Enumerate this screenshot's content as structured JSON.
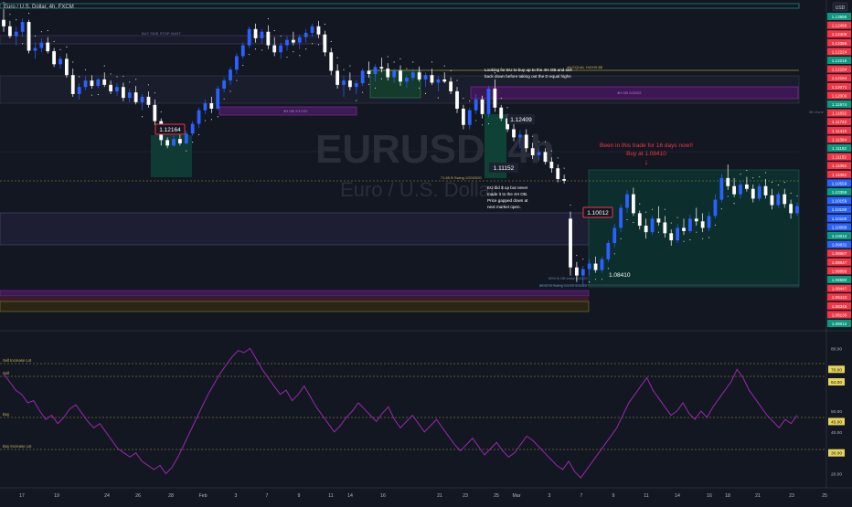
{
  "header": {
    "title": "Euro / U.S. Dollar, 4h, FXCM",
    "currency": "USD"
  },
  "watermark": {
    "symbol": "EURUSD, 4h",
    "name": "Euro / U.S. Dollar"
  },
  "colors": {
    "bg": "#131722",
    "up": "#2962ff",
    "down": "#ffffff",
    "price_label": "#f23645",
    "green_label": "#089981",
    "blue_label": "#2962ff",
    "rsi": "#9c27b0",
    "dots": "#ffffff",
    "zone_dark": "#1e2130",
    "teal_zone": "#0d3b35",
    "purple_zone": "#4a1d6b",
    "yellow_zone": "#3a3318"
  },
  "annotations": {
    "top_zone_label": "BUY SIDE STOP HUNT",
    "ob_label_1": "4H OB 2/17/22",
    "ob_label_2": "4H OB 2/22/22",
    "equal_highs": "4H EQUAL HIGHS $$",
    "looking_for": [
      "Looking for EU to buy up to the 4H OB and sell",
      "back down before taking out the D equal highs"
    ],
    "swing_label": "71.85 B Swing 1/20/2020",
    "eu_did": [
      "EU did $ up but never",
      "made it to the 4H OB.",
      "Price gapped down at",
      "next market open."
    ],
    "fib_label_1": "50% B OB ends 5/11/22",
    "fib_label_2": "88.62 B Swing 1/2/20 5/11/22",
    "been_in_trade": [
      "Been in this trade for 16 days now!!",
      "Buy at 1.08410"
    ],
    "arrow": "↓",
    "fifth_zone": "5th Zone"
  },
  "price_callouts": {
    "p1": "1.12164",
    "p2": "1.12409",
    "p3": "1.11152",
    "p4": "1.10012",
    "p5": "1.08410"
  },
  "price_axis": [
    "1.13555",
    "1.12468",
    "1.12409",
    "1.12356",
    "1.12224",
    "1.12216",
    "1.12164",
    "1.12154",
    "1.12071",
    "1.12006",
    "1.11974",
    "1.11832",
    "1.11722",
    "1.11410",
    "1.11364",
    "1.11152",
    "1.11152",
    "1.11062",
    "1.11062",
    "1.10559",
    "1.10359",
    "1.10159",
    "1.10190",
    "1.10100",
    "1.10089",
    "1.10012",
    "1.09831",
    "1.08987",
    "1.08947",
    "1.08890",
    "1.08580",
    "1.08447",
    "1.08410",
    "1.08346",
    "1.08130",
    "1.08012"
  ],
  "rsi_axis": [
    "80.00",
    "70.00",
    "64.00",
    "50.00",
    "45.00",
    "40.00",
    "30.00",
    "20.00"
  ],
  "rsi_levels": {
    "sell_increase": {
      "label": "Sell Increase Lot",
      "value": "70.00"
    },
    "sell": {
      "label": "Sell",
      "value": "64.00"
    },
    "buy": {
      "label": "Buy",
      "value": "45.00"
    },
    "buy_increase": {
      "label": "Buy Increase Lot",
      "value": "30.00"
    }
  },
  "time_axis": [
    "17",
    "19",
    "24",
    "26",
    "28",
    "Feb",
    "3",
    "7",
    "9",
    "11",
    "14",
    "16",
    "21",
    "23",
    "25",
    "Mar",
    "3",
    "7",
    "9",
    "11",
    "14",
    "16",
    "18",
    "21",
    "23",
    "25"
  ],
  "chart_data": {
    "type": "candlestick",
    "title": "Euro / U.S. Dollar, 4h, FXCM",
    "ylim": [
      1.0795,
      1.1365
    ],
    "rsi_ylim": [
      15,
      85
    ],
    "candles": [
      [
        1.1352,
        1.1372,
        1.133,
        1.134
      ],
      [
        1.134,
        1.135,
        1.1318,
        1.1322
      ],
      [
        1.1322,
        1.134,
        1.1305,
        1.133
      ],
      [
        1.133,
        1.1355,
        1.132,
        1.1348
      ],
      [
        1.1348,
        1.1352,
        1.129,
        1.1295
      ],
      [
        1.1295,
        1.131,
        1.128,
        1.13
      ],
      [
        1.13,
        1.1318,
        1.1292,
        1.131
      ],
      [
        1.131,
        1.132,
        1.129,
        1.1294
      ],
      [
        1.1294,
        1.13,
        1.1265,
        1.127
      ],
      [
        1.127,
        1.1285,
        1.1262,
        1.128
      ],
      [
        1.128,
        1.129,
        1.1245,
        1.125
      ],
      [
        1.125,
        1.1262,
        1.121,
        1.1215
      ],
      [
        1.1215,
        1.1235,
        1.1205,
        1.1228
      ],
      [
        1.1228,
        1.1248,
        1.1222,
        1.124
      ],
      [
        1.124,
        1.125,
        1.1225,
        1.123
      ],
      [
        1.123,
        1.1245,
        1.1226,
        1.1242
      ],
      [
        1.1242,
        1.1255,
        1.1228,
        1.1232
      ],
      [
        1.1232,
        1.124,
        1.1215,
        1.122
      ],
      [
        1.122,
        1.1235,
        1.1212,
        1.1228
      ],
      [
        1.1228,
        1.1236,
        1.1202,
        1.1208
      ],
      [
        1.1208,
        1.1225,
        1.12,
        1.1218
      ],
      [
        1.1218,
        1.123,
        1.1196,
        1.12
      ],
      [
        1.12,
        1.1215,
        1.1185,
        1.121
      ],
      [
        1.121,
        1.122,
        1.119,
        1.1195
      ],
      [
        1.1195,
        1.1205,
        1.1158,
        1.1165
      ],
      [
        1.1165,
        1.117,
        1.112,
        1.113
      ],
      [
        1.113,
        1.1135,
        1.1115,
        1.112
      ],
      [
        1.112,
        1.1138,
        1.1118,
        1.1132
      ],
      [
        1.1132,
        1.114,
        1.112,
        1.1124
      ],
      [
        1.1124,
        1.1148,
        1.1122,
        1.1142
      ],
      [
        1.1142,
        1.1165,
        1.1138,
        1.116
      ],
      [
        1.116,
        1.119,
        1.1152,
        1.1185
      ],
      [
        1.1185,
        1.1205,
        1.1178,
        1.1198
      ],
      [
        1.1198,
        1.121,
        1.118,
        1.1188
      ],
      [
        1.1188,
        1.123,
        1.1185,
        1.1225
      ],
      [
        1.1225,
        1.1245,
        1.1218,
        1.124
      ],
      [
        1.124,
        1.1265,
        1.1232,
        1.126
      ],
      [
        1.126,
        1.129,
        1.1252,
        1.1285
      ],
      [
        1.1285,
        1.131,
        1.128,
        1.1305
      ],
      [
        1.1305,
        1.134,
        1.13,
        1.1335
      ],
      [
        1.1335,
        1.1345,
        1.131,
        1.1318
      ],
      [
        1.1318,
        1.1335,
        1.1308,
        1.133
      ],
      [
        1.133,
        1.1342,
        1.1298,
        1.1305
      ],
      [
        1.1305,
        1.132,
        1.1285,
        1.1292
      ],
      [
        1.1292,
        1.131,
        1.128,
        1.1305
      ],
      [
        1.1305,
        1.1322,
        1.1295,
        1.1315
      ],
      [
        1.1315,
        1.133,
        1.1305,
        1.131
      ],
      [
        1.131,
        1.1325,
        1.1298,
        1.132
      ],
      [
        1.132,
        1.1335,
        1.131,
        1.1328
      ],
      [
        1.1328,
        1.1345,
        1.132,
        1.134
      ],
      [
        1.134,
        1.135,
        1.1318,
        1.1325
      ],
      [
        1.1325,
        1.1332,
        1.1285,
        1.1292
      ],
      [
        1.1292,
        1.13,
        1.125,
        1.1258
      ],
      [
        1.1258,
        1.127,
        1.1225,
        1.1232
      ],
      [
        1.1232,
        1.1248,
        1.121,
        1.124
      ],
      [
        1.124,
        1.1255,
        1.1222,
        1.1228
      ],
      [
        1.1228,
        1.124,
        1.1215,
        1.1235
      ],
      [
        1.1235,
        1.1262,
        1.123,
        1.1258
      ],
      [
        1.1258,
        1.1275,
        1.1245,
        1.1252
      ],
      [
        1.1252,
        1.127,
        1.1238,
        1.1265
      ],
      [
        1.1265,
        1.1282,
        1.1255,
        1.1262
      ],
      [
        1.1262,
        1.1272,
        1.124,
        1.1246
      ],
      [
        1.1246,
        1.1262,
        1.1236,
        1.1258
      ],
      [
        1.1258,
        1.1268,
        1.123,
        1.1238
      ],
      [
        1.1238,
        1.125,
        1.1226,
        1.1245
      ],
      [
        1.1245,
        1.1262,
        1.124,
        1.1255
      ],
      [
        1.1255,
        1.1266,
        1.1238,
        1.1242
      ],
      [
        1.1242,
        1.1255,
        1.1228,
        1.125
      ],
      [
        1.125,
        1.1262,
        1.1232,
        1.1236
      ],
      [
        1.1236,
        1.1248,
        1.122,
        1.1242
      ],
      [
        1.1242,
        1.1255,
        1.1235,
        1.1238
      ],
      [
        1.1238,
        1.1246,
        1.1215,
        1.122
      ],
      [
        1.122,
        1.1228,
        1.118,
        1.1188
      ],
      [
        1.1188,
        1.1195,
        1.115,
        1.1158
      ],
      [
        1.1158,
        1.119,
        1.115,
        1.1185
      ],
      [
        1.1185,
        1.1215,
        1.1178,
        1.1205
      ],
      [
        1.1205,
        1.1212,
        1.117,
        1.1178
      ],
      [
        1.1178,
        1.123,
        1.1172,
        1.1225
      ],
      [
        1.1225,
        1.1242,
        1.1182,
        1.119
      ],
      [
        1.119,
        1.1195,
        1.1165,
        1.117
      ],
      [
        1.117,
        1.1178,
        1.1145,
        1.115
      ],
      [
        1.115,
        1.116,
        1.1128,
        1.1135
      ],
      [
        1.1135,
        1.1148,
        1.1115,
        1.114
      ],
      [
        1.114,
        1.115,
        1.1108,
        1.1115
      ],
      [
        1.1115,
        1.1125,
        1.1095,
        1.1102
      ],
      [
        1.1102,
        1.1115,
        1.1092,
        1.1108
      ],
      [
        1.1108,
        1.1115,
        1.1085,
        1.109
      ],
      [
        1.109,
        1.1098,
        1.107,
        1.1078
      ],
      [
        1.1078,
        1.1085,
        1.1052,
        1.1058
      ],
      [
        1.1058,
        1.1066,
        1.105,
        1.1055
      ],
      [
        1.0985,
        1.0998,
        1.088,
        1.0895
      ],
      [
        1.0895,
        1.0905,
        1.0868,
        1.088
      ],
      [
        1.088,
        1.0898,
        1.086,
        1.0892
      ],
      [
        1.0892,
        1.091,
        1.088,
        1.0902
      ],
      [
        1.0902,
        1.0915,
        1.0885,
        1.089
      ],
      [
        1.089,
        1.0915,
        1.0885,
        1.091
      ],
      [
        1.091,
        1.0945,
        1.0905,
        1.094
      ],
      [
        1.094,
        1.0975,
        1.0932,
        1.0968
      ],
      [
        1.0968,
        1.1012,
        1.096,
        1.1005
      ],
      [
        1.1005,
        1.1038,
        1.0995,
        1.103
      ],
      [
        1.103,
        1.1042,
        1.099,
        1.0995
      ],
      [
        1.0995,
        1.1,
        1.0965,
        1.0972
      ],
      [
        1.0972,
        1.0985,
        1.0948,
        1.096
      ],
      [
        1.096,
        1.099,
        1.0955,
        1.0985
      ],
      [
        1.0985,
        1.1008,
        1.0972,
        1.0978
      ],
      [
        1.0978,
        1.099,
        1.095,
        1.0958
      ],
      [
        1.0958,
        1.0965,
        1.0935,
        1.0945
      ],
      [
        1.0945,
        1.0975,
        1.094,
        1.0968
      ],
      [
        1.0968,
        1.0985,
        1.0955,
        1.0962
      ],
      [
        1.0962,
        1.0992,
        1.0958,
        1.0985
      ],
      [
        1.0985,
        1.1005,
        1.0972,
        1.098
      ],
      [
        1.098,
        1.0995,
        1.096,
        1.0968
      ],
      [
        1.0968,
        1.0998,
        1.0962,
        1.099
      ],
      [
        1.099,
        1.103,
        1.0985,
        1.102
      ],
      [
        1.102,
        1.1068,
        1.1015,
        1.106
      ],
      [
        1.106,
        1.1085,
        1.1038,
        1.1045
      ],
      [
        1.1045,
        1.106,
        1.1025,
        1.103
      ],
      [
        1.103,
        1.1055,
        1.1022,
        1.1048
      ],
      [
        1.1048,
        1.1062,
        1.1035,
        1.104
      ],
      [
        1.104,
        1.1048,
        1.1015,
        1.1022
      ],
      [
        1.1022,
        1.105,
        1.1018,
        1.1045
      ],
      [
        1.1045,
        1.1058,
        1.1022,
        1.1028
      ],
      [
        1.1028,
        1.104,
        1.1002,
        1.101
      ],
      [
        1.101,
        1.1035,
        1.1005,
        1.103
      ],
      [
        1.103,
        1.104,
        1.1005,
        1.1012
      ],
      [
        1.1012,
        1.102,
        1.0985,
        1.0995
      ],
      [
        1.0995,
        1.1015,
        1.099,
        1.1008
      ]
    ],
    "rsi": [
      68,
      64,
      60,
      58,
      54,
      55,
      50,
      46,
      48,
      44,
      47,
      51,
      53,
      49,
      45,
      42,
      44,
      40,
      36,
      32,
      30,
      28,
      30,
      26,
      24,
      22,
      24,
      20,
      23,
      28,
      34,
      40,
      46,
      52,
      58,
      63,
      68,
      72,
      76,
      79,
      78,
      80,
      75,
      70,
      66,
      62,
      58,
      60,
      55,
      58,
      62,
      57,
      52,
      48,
      44,
      40,
      43,
      47,
      50,
      54,
      51,
      48,
      45,
      49,
      52,
      46,
      42,
      45,
      48,
      44,
      40,
      43,
      46,
      42,
      38,
      34,
      31,
      34,
      37,
      33,
      29,
      32,
      35,
      31,
      28,
      30,
      34,
      38,
      36,
      33,
      30,
      27,
      24,
      22,
      26,
      21,
      18,
      22,
      26,
      30,
      34,
      38,
      42,
      48,
      54,
      58,
      62,
      66,
      60,
      56,
      52,
      48,
      50,
      54,
      49,
      46,
      50,
      47,
      52,
      56,
      60,
      64,
      70,
      66,
      60,
      56,
      52,
      48,
      45,
      42,
      46,
      44,
      48
    ]
  }
}
